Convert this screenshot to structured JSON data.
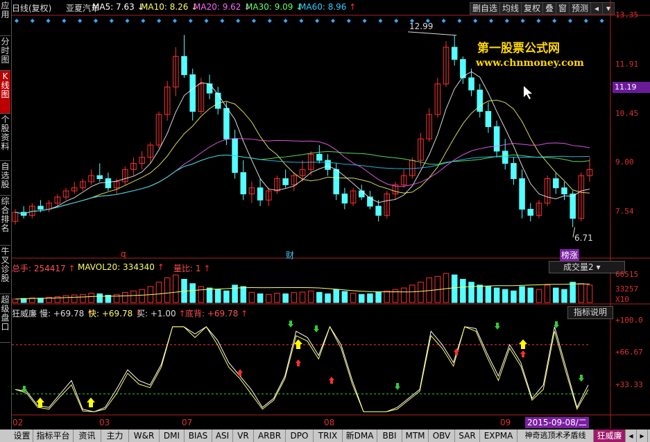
{
  "sidebar": {
    "tabs": [
      {
        "label": "应用"
      },
      {
        "label": "分时图"
      },
      {
        "label": "K线图"
      },
      {
        "label": "个股资料"
      },
      {
        "label": "自选股"
      },
      {
        "label": "综合排名"
      },
      {
        "label": "牛叉诊股"
      },
      {
        "label": "超级盘口"
      }
    ]
  },
  "header": {
    "period": "日线(复权)",
    "stock": "亚夏汽车",
    "ma5": "MA5: 7.63",
    "ma10": "MA10: 8.26",
    "ma20": "MA20: 9.62",
    "ma30": "MA30: 9.09",
    "ma60": "MA60: 8.96",
    "buttons": [
      "删自选",
      "均线",
      "复权",
      "叠",
      "窗",
      "预测"
    ]
  },
  "colors": {
    "up": "#ff3030",
    "down": "#54ffff",
    "ma5": "#ffffff",
    "ma10": "#ffff66",
    "ma20": "#ff66ff",
    "ma30": "#66ff66",
    "ma60": "#33ccff"
  },
  "price_axis": [
    "13.35",
    "11.91",
    "10.45",
    "9.00",
    "7.54"
  ],
  "current_price": "11.19",
  "annotations": {
    "high": "12.99",
    "low": "6.71",
    "marker_q": "q",
    "marker_cai": "财",
    "marker_bang": "榜涨"
  },
  "watermark": {
    "line1": "第一股票公式网",
    "line2": "www.chnmoney.com"
  },
  "volume": {
    "total": "总手: 254417",
    "mavol": "MAVOL20: 334340",
    "ratio": "量比: 1",
    "selector": "成交量2",
    "axis": [
      "66515",
      "33257",
      "X10"
    ]
  },
  "indicator": {
    "name": "狂威廉",
    "slow": "慢: +69.78",
    "fast": "快: +69.78",
    "buy": "买: +1.00",
    "divergence": "底背: +69.78",
    "help": "指标说明",
    "axis": [
      "+100.0",
      "+66.67",
      "+33.33"
    ]
  },
  "x_axis": [
    "02",
    "03",
    "07",
    "08",
    "09"
  ],
  "cursor_date": "2015-09-08/二",
  "bottom_tabs": [
    "设置",
    "指标平台",
    "资讯",
    "主力",
    "W&R",
    "DMI",
    "BIAS",
    "ASI",
    "VR",
    "ARBR",
    "DPO",
    "TRIX",
    "新DMA",
    "BBI",
    "MTM",
    "OBV",
    "SAR",
    "EXPMA",
    "神奇逃顶术矛盾线",
    "狂威廉"
  ],
  "chart_data": [
    {
      "type": "candlestick",
      "title": "亚夏汽车 日线(复权)",
      "ylim": [
        6.2,
        13.6
      ],
      "candles": [
        [
          6.9,
          7.3,
          6.8,
          7.2
        ],
        [
          7.2,
          7.4,
          7.0,
          7.1
        ],
        [
          7.1,
          7.5,
          7.0,
          7.4
        ],
        [
          7.4,
          7.6,
          7.2,
          7.3
        ],
        [
          7.3,
          7.6,
          7.2,
          7.5
        ],
        [
          7.5,
          7.8,
          7.4,
          7.7
        ],
        [
          7.7,
          8.0,
          7.6,
          7.9
        ],
        [
          7.9,
          8.2,
          7.8,
          8.0
        ],
        [
          8.0,
          8.3,
          7.9,
          8.2
        ],
        [
          8.2,
          8.6,
          8.1,
          8.4
        ],
        [
          8.4,
          8.8,
          8.2,
          8.3
        ],
        [
          8.3,
          8.5,
          7.9,
          8.0
        ],
        [
          8.0,
          8.3,
          7.8,
          8.2
        ],
        [
          8.2,
          8.7,
          8.1,
          8.6
        ],
        [
          8.6,
          9.0,
          8.4,
          8.8
        ],
        [
          8.8,
          9.2,
          8.6,
          9.0
        ],
        [
          9.0,
          9.5,
          8.8,
          9.4
        ],
        [
          9.4,
          10.5,
          9.3,
          10.4
        ],
        [
          10.4,
          11.5,
          10.2,
          11.3
        ],
        [
          11.3,
          12.6,
          11.0,
          12.3
        ],
        [
          12.3,
          13.0,
          11.6,
          11.7
        ],
        [
          11.7,
          11.9,
          10.2,
          10.5
        ],
        [
          10.5,
          11.6,
          10.4,
          11.4
        ],
        [
          11.4,
          11.7,
          10.9,
          11.1
        ],
        [
          11.1,
          11.3,
          10.4,
          10.6
        ],
        [
          10.6,
          10.8,
          9.4,
          9.6
        ],
        [
          9.6,
          9.9,
          8.3,
          8.5
        ],
        [
          8.5,
          8.9,
          7.6,
          7.8
        ],
        [
          7.8,
          8.2,
          7.5,
          8.0
        ],
        [
          8.0,
          8.3,
          7.4,
          7.6
        ],
        [
          7.6,
          8.0,
          7.4,
          7.9
        ],
        [
          7.9,
          8.4,
          7.8,
          8.3
        ],
        [
          8.3,
          8.6,
          8.0,
          8.1
        ],
        [
          8.1,
          8.5,
          7.9,
          8.4
        ],
        [
          8.4,
          8.9,
          8.2,
          8.6
        ],
        [
          8.6,
          9.2,
          8.4,
          9.1
        ],
        [
          9.1,
          9.4,
          8.8,
          8.9
        ],
        [
          8.9,
          9.1,
          8.4,
          8.6
        ],
        [
          8.6,
          8.8,
          7.6,
          7.8
        ],
        [
          7.8,
          8.0,
          7.3,
          7.5
        ],
        [
          7.5,
          8.0,
          7.4,
          7.9
        ],
        [
          7.9,
          8.1,
          7.6,
          7.7
        ],
        [
          7.7,
          7.9,
          7.3,
          7.4
        ],
        [
          7.4,
          7.6,
          6.9,
          7.1
        ],
        [
          7.1,
          7.9,
          7.0,
          7.8
        ],
        [
          7.8,
          8.2,
          7.6,
          8.1
        ],
        [
          8.1,
          8.6,
          8.0,
          8.4
        ],
        [
          8.4,
          9.0,
          8.3,
          8.9
        ],
        [
          8.9,
          9.8,
          8.7,
          9.6
        ],
        [
          9.6,
          10.6,
          9.5,
          10.4
        ],
        [
          10.4,
          11.6,
          10.3,
          11.4
        ],
        [
          11.4,
          12.8,
          11.3,
          12.6
        ],
        [
          12.6,
          12.99,
          12.0,
          12.2
        ],
        [
          12.2,
          12.3,
          11.4,
          11.6
        ],
        [
          11.6,
          11.9,
          11.0,
          11.2
        ],
        [
          11.2,
          11.4,
          10.3,
          10.5
        ],
        [
          10.5,
          10.8,
          9.8,
          10.0
        ],
        [
          10.0,
          10.2,
          9.0,
          9.2
        ],
        [
          9.2,
          9.6,
          8.6,
          8.8
        ],
        [
          8.8,
          9.0,
          8.1,
          8.3
        ],
        [
          8.3,
          8.6,
          7.0,
          7.3
        ],
        [
          7.3,
          7.5,
          6.9,
          7.1
        ],
        [
          7.1,
          7.6,
          7.0,
          7.5
        ],
        [
          7.5,
          8.4,
          7.4,
          8.3
        ],
        [
          8.3,
          8.5,
          7.8,
          8.0
        ],
        [
          8.0,
          8.2,
          7.6,
          7.8
        ],
        [
          7.8,
          7.9,
          6.71,
          7.0
        ],
        [
          7.0,
          8.5,
          6.9,
          8.4
        ],
        [
          8.4,
          9.0,
          8.2,
          8.6
        ]
      ]
    },
    {
      "type": "bar",
      "title": "成交量",
      "values": [
        12,
        14,
        16,
        15,
        18,
        20,
        24,
        26,
        28,
        32,
        30,
        25,
        28,
        35,
        40,
        45,
        55,
        70,
        85,
        95,
        80,
        65,
        55,
        50,
        45,
        40,
        60,
        55,
        35,
        30,
        28,
        32,
        30,
        34,
        36,
        40,
        35,
        30,
        45,
        38,
        32,
        28,
        30,
        35,
        40,
        45,
        50,
        60,
        70,
        85,
        90,
        100,
        95,
        80,
        70,
        60,
        55,
        50,
        45,
        40,
        55,
        50,
        45,
        60,
        50,
        45,
        70,
        65,
        60
      ]
    },
    {
      "type": "line",
      "title": "狂威廉",
      "ylim": [
        0,
        110
      ],
      "series": [
        {
          "name": "慢",
          "values": [
            30,
            28,
            12,
            10,
            25,
            40,
            8,
            5,
            10,
            30,
            52,
            40,
            35,
            58,
            100,
            100,
            92,
            100,
            85,
            60,
            45,
            30,
            10,
            20,
            45,
            95,
            88,
            68,
            100,
            80,
            40,
            5,
            5,
            5,
            10,
            20,
            30,
            95,
            80,
            60,
            100,
            98,
            70,
            45,
            80,
            60,
            20,
            35,
            100,
            55,
            10,
            35
          ]
        },
        {
          "name": "快",
          "values": [
            30,
            26,
            10,
            8,
            22,
            35,
            6,
            5,
            8,
            25,
            48,
            36,
            32,
            55,
            100,
            100,
            88,
            100,
            80,
            55,
            42,
            25,
            8,
            18,
            42,
            90,
            84,
            64,
            100,
            76,
            36,
            5,
            5,
            5,
            8,
            18,
            28,
            90,
            76,
            56,
            100,
            95,
            66,
            40,
            76,
            56,
            18,
            30,
            95,
            50,
            8,
            30
          ]
        }
      ]
    }
  ]
}
